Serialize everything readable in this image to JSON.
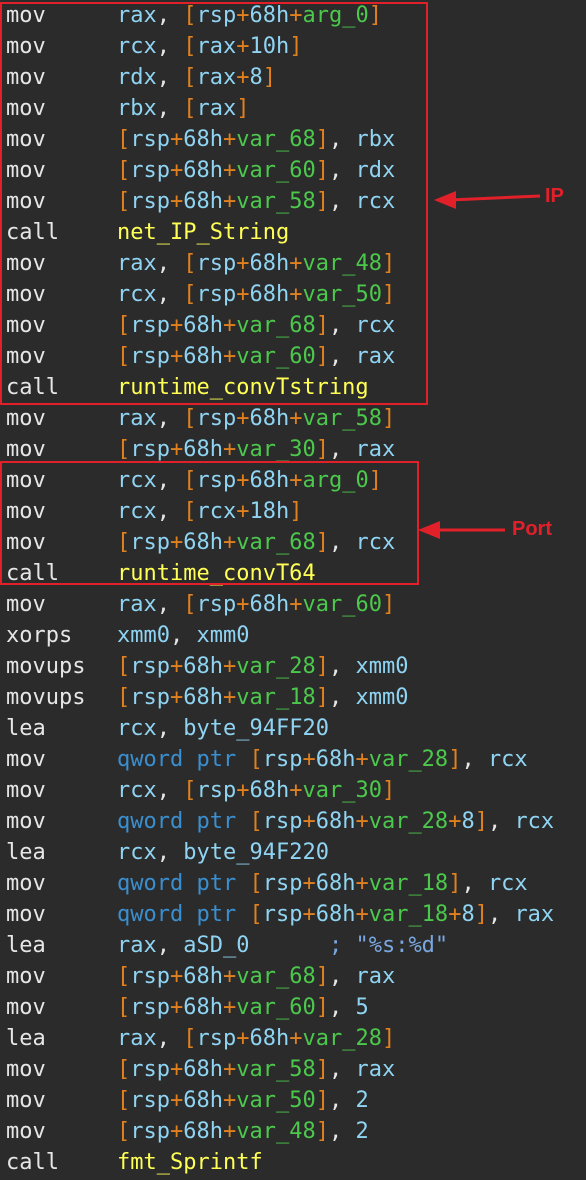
{
  "lines": [
    {
      "m": "mov",
      "t": [
        [
          "reg",
          "rax"
        ],
        [
          "punc",
          ", "
        ],
        [
          "br",
          "["
        ],
        [
          "reg",
          "rsp"
        ],
        [
          "plus",
          "+"
        ],
        [
          "num",
          "68h"
        ],
        [
          "plus",
          "+"
        ],
        [
          "var",
          "arg_0"
        ],
        [
          "br",
          "]"
        ]
      ]
    },
    {
      "m": "mov",
      "t": [
        [
          "reg",
          "rcx"
        ],
        [
          "punc",
          ", "
        ],
        [
          "br",
          "["
        ],
        [
          "reg",
          "rax"
        ],
        [
          "plus",
          "+"
        ],
        [
          "num",
          "10h"
        ],
        [
          "br",
          "]"
        ]
      ]
    },
    {
      "m": "mov",
      "t": [
        [
          "reg",
          "rdx"
        ],
        [
          "punc",
          ", "
        ],
        [
          "br",
          "["
        ],
        [
          "reg",
          "rax"
        ],
        [
          "plus",
          "+"
        ],
        [
          "num",
          "8"
        ],
        [
          "br",
          "]"
        ]
      ]
    },
    {
      "m": "mov",
      "t": [
        [
          "reg",
          "rbx"
        ],
        [
          "punc",
          ", "
        ],
        [
          "br",
          "["
        ],
        [
          "reg",
          "rax"
        ],
        [
          "br",
          "]"
        ]
      ]
    },
    {
      "m": "mov",
      "t": [
        [
          "br",
          "["
        ],
        [
          "reg",
          "rsp"
        ],
        [
          "plus",
          "+"
        ],
        [
          "num",
          "68h"
        ],
        [
          "plus",
          "+"
        ],
        [
          "var",
          "var_68"
        ],
        [
          "br",
          "]"
        ],
        [
          "punc",
          ", "
        ],
        [
          "reg",
          "rbx"
        ]
      ]
    },
    {
      "m": "mov",
      "t": [
        [
          "br",
          "["
        ],
        [
          "reg",
          "rsp"
        ],
        [
          "plus",
          "+"
        ],
        [
          "num",
          "68h"
        ],
        [
          "plus",
          "+"
        ],
        [
          "var",
          "var_60"
        ],
        [
          "br",
          "]"
        ],
        [
          "punc",
          ", "
        ],
        [
          "reg",
          "rdx"
        ]
      ]
    },
    {
      "m": "mov",
      "t": [
        [
          "br",
          "["
        ],
        [
          "reg",
          "rsp"
        ],
        [
          "plus",
          "+"
        ],
        [
          "num",
          "68h"
        ],
        [
          "plus",
          "+"
        ],
        [
          "var",
          "var_58"
        ],
        [
          "br",
          "]"
        ],
        [
          "punc",
          ", "
        ],
        [
          "reg",
          "rcx"
        ]
      ]
    },
    {
      "m": "call",
      "t": [
        [
          "func",
          "net_IP_String"
        ]
      ]
    },
    {
      "m": "mov",
      "t": [
        [
          "reg",
          "rax"
        ],
        [
          "punc",
          ", "
        ],
        [
          "br",
          "["
        ],
        [
          "reg",
          "rsp"
        ],
        [
          "plus",
          "+"
        ],
        [
          "num",
          "68h"
        ],
        [
          "plus",
          "+"
        ],
        [
          "var",
          "var_48"
        ],
        [
          "br",
          "]"
        ]
      ]
    },
    {
      "m": "mov",
      "t": [
        [
          "reg",
          "rcx"
        ],
        [
          "punc",
          ", "
        ],
        [
          "br",
          "["
        ],
        [
          "reg",
          "rsp"
        ],
        [
          "plus",
          "+"
        ],
        [
          "num",
          "68h"
        ],
        [
          "plus",
          "+"
        ],
        [
          "var",
          "var_50"
        ],
        [
          "br",
          "]"
        ]
      ]
    },
    {
      "m": "mov",
      "t": [
        [
          "br",
          "["
        ],
        [
          "reg",
          "rsp"
        ],
        [
          "plus",
          "+"
        ],
        [
          "num",
          "68h"
        ],
        [
          "plus",
          "+"
        ],
        [
          "var",
          "var_68"
        ],
        [
          "br",
          "]"
        ],
        [
          "punc",
          ", "
        ],
        [
          "reg",
          "rcx"
        ]
      ]
    },
    {
      "m": "mov",
      "t": [
        [
          "br",
          "["
        ],
        [
          "reg",
          "rsp"
        ],
        [
          "plus",
          "+"
        ],
        [
          "num",
          "68h"
        ],
        [
          "plus",
          "+"
        ],
        [
          "var",
          "var_60"
        ],
        [
          "br",
          "]"
        ],
        [
          "punc",
          ", "
        ],
        [
          "reg",
          "rax"
        ]
      ]
    },
    {
      "m": "call",
      "t": [
        [
          "func",
          "runtime_convTstring"
        ]
      ]
    },
    {
      "m": "mov",
      "t": [
        [
          "reg",
          "rax"
        ],
        [
          "punc",
          ", "
        ],
        [
          "br",
          "["
        ],
        [
          "reg",
          "rsp"
        ],
        [
          "plus",
          "+"
        ],
        [
          "num",
          "68h"
        ],
        [
          "plus",
          "+"
        ],
        [
          "var",
          "var_58"
        ],
        [
          "br",
          "]"
        ]
      ]
    },
    {
      "m": "mov",
      "t": [
        [
          "br",
          "["
        ],
        [
          "reg",
          "rsp"
        ],
        [
          "plus",
          "+"
        ],
        [
          "num",
          "68h"
        ],
        [
          "plus",
          "+"
        ],
        [
          "var",
          "var_30"
        ],
        [
          "br",
          "]"
        ],
        [
          "punc",
          ", "
        ],
        [
          "reg",
          "rax"
        ]
      ]
    },
    {
      "m": "mov",
      "t": [
        [
          "reg",
          "rcx"
        ],
        [
          "punc",
          ", "
        ],
        [
          "br",
          "["
        ],
        [
          "reg",
          "rsp"
        ],
        [
          "plus",
          "+"
        ],
        [
          "num",
          "68h"
        ],
        [
          "plus",
          "+"
        ],
        [
          "var",
          "arg_0"
        ],
        [
          "br",
          "]"
        ]
      ]
    },
    {
      "m": "mov",
      "t": [
        [
          "reg",
          "rcx"
        ],
        [
          "punc",
          ", "
        ],
        [
          "br",
          "["
        ],
        [
          "reg",
          "rcx"
        ],
        [
          "plus",
          "+"
        ],
        [
          "num",
          "18h"
        ],
        [
          "br",
          "]"
        ]
      ]
    },
    {
      "m": "mov",
      "t": [
        [
          "br",
          "["
        ],
        [
          "reg",
          "rsp"
        ],
        [
          "plus",
          "+"
        ],
        [
          "num",
          "68h"
        ],
        [
          "plus",
          "+"
        ],
        [
          "var",
          "var_68"
        ],
        [
          "br",
          "]"
        ],
        [
          "punc",
          ", "
        ],
        [
          "reg",
          "rcx"
        ]
      ]
    },
    {
      "m": "call",
      "t": [
        [
          "func",
          "runtime_convT64"
        ]
      ]
    },
    {
      "m": "mov",
      "t": [
        [
          "reg",
          "rax"
        ],
        [
          "punc",
          ", "
        ],
        [
          "br",
          "["
        ],
        [
          "reg",
          "rsp"
        ],
        [
          "plus",
          "+"
        ],
        [
          "num",
          "68h"
        ],
        [
          "plus",
          "+"
        ],
        [
          "var",
          "var_60"
        ],
        [
          "br",
          "]"
        ]
      ]
    },
    {
      "m": "xorps",
      "t": [
        [
          "reg",
          "xmm0"
        ],
        [
          "punc",
          ", "
        ],
        [
          "reg",
          "xmm0"
        ]
      ]
    },
    {
      "m": "movups",
      "t": [
        [
          "br",
          "["
        ],
        [
          "reg",
          "rsp"
        ],
        [
          "plus",
          "+"
        ],
        [
          "num",
          "68h"
        ],
        [
          "plus",
          "+"
        ],
        [
          "var",
          "var_28"
        ],
        [
          "br",
          "]"
        ],
        [
          "punc",
          ", "
        ],
        [
          "reg",
          "xmm0"
        ]
      ]
    },
    {
      "m": "movups",
      "t": [
        [
          "br",
          "["
        ],
        [
          "reg",
          "rsp"
        ],
        [
          "plus",
          "+"
        ],
        [
          "num",
          "68h"
        ],
        [
          "plus",
          "+"
        ],
        [
          "var",
          "var_18"
        ],
        [
          "br",
          "]"
        ],
        [
          "punc",
          ", "
        ],
        [
          "reg",
          "xmm0"
        ]
      ]
    },
    {
      "m": "lea",
      "t": [
        [
          "reg",
          "rcx"
        ],
        [
          "punc",
          ", "
        ],
        [
          "reg",
          "byte_94FF20"
        ]
      ]
    },
    {
      "m": "mov",
      "t": [
        [
          "kw",
          "qword ptr "
        ],
        [
          "br",
          "["
        ],
        [
          "reg",
          "rsp"
        ],
        [
          "plus",
          "+"
        ],
        [
          "num",
          "68h"
        ],
        [
          "plus",
          "+"
        ],
        [
          "var",
          "var_28"
        ],
        [
          "br",
          "]"
        ],
        [
          "punc",
          ", "
        ],
        [
          "reg",
          "rcx"
        ]
      ]
    },
    {
      "m": "mov",
      "t": [
        [
          "reg",
          "rcx"
        ],
        [
          "punc",
          ", "
        ],
        [
          "br",
          "["
        ],
        [
          "reg",
          "rsp"
        ],
        [
          "plus",
          "+"
        ],
        [
          "num",
          "68h"
        ],
        [
          "plus",
          "+"
        ],
        [
          "var",
          "var_30"
        ],
        [
          "br",
          "]"
        ]
      ]
    },
    {
      "m": "mov",
      "t": [
        [
          "kw",
          "qword ptr "
        ],
        [
          "br",
          "["
        ],
        [
          "reg",
          "rsp"
        ],
        [
          "plus",
          "+"
        ],
        [
          "num",
          "68h"
        ],
        [
          "plus",
          "+"
        ],
        [
          "var",
          "var_28"
        ],
        [
          "plus",
          "+"
        ],
        [
          "num",
          "8"
        ],
        [
          "br",
          "]"
        ],
        [
          "punc",
          ", "
        ],
        [
          "reg",
          "rcx"
        ]
      ]
    },
    {
      "m": "lea",
      "t": [
        [
          "reg",
          "rcx"
        ],
        [
          "punc",
          ", "
        ],
        [
          "reg",
          "byte_94F220"
        ]
      ]
    },
    {
      "m": "mov",
      "t": [
        [
          "kw",
          "qword ptr "
        ],
        [
          "br",
          "["
        ],
        [
          "reg",
          "rsp"
        ],
        [
          "plus",
          "+"
        ],
        [
          "num",
          "68h"
        ],
        [
          "plus",
          "+"
        ],
        [
          "var",
          "var_18"
        ],
        [
          "br",
          "]"
        ],
        [
          "punc",
          ", "
        ],
        [
          "reg",
          "rcx"
        ]
      ]
    },
    {
      "m": "mov",
      "t": [
        [
          "kw",
          "qword ptr "
        ],
        [
          "br",
          "["
        ],
        [
          "reg",
          "rsp"
        ],
        [
          "plus",
          "+"
        ],
        [
          "num",
          "68h"
        ],
        [
          "plus",
          "+"
        ],
        [
          "var",
          "var_18"
        ],
        [
          "plus",
          "+"
        ],
        [
          "num",
          "8"
        ],
        [
          "br",
          "]"
        ],
        [
          "punc",
          ", "
        ],
        [
          "reg",
          "rax"
        ]
      ]
    },
    {
      "m": "lea",
      "t": [
        [
          "reg",
          "rax"
        ],
        [
          "punc",
          ", "
        ],
        [
          "reg",
          "aSD_0"
        ],
        [
          "punc",
          "      "
        ],
        [
          "cmt",
          "; \"%s:%d\""
        ]
      ]
    },
    {
      "m": "mov",
      "t": [
        [
          "br",
          "["
        ],
        [
          "reg",
          "rsp"
        ],
        [
          "plus",
          "+"
        ],
        [
          "num",
          "68h"
        ],
        [
          "plus",
          "+"
        ],
        [
          "var",
          "var_68"
        ],
        [
          "br",
          "]"
        ],
        [
          "punc",
          ", "
        ],
        [
          "reg",
          "rax"
        ]
      ]
    },
    {
      "m": "mov",
      "t": [
        [
          "br",
          "["
        ],
        [
          "reg",
          "rsp"
        ],
        [
          "plus",
          "+"
        ],
        [
          "num",
          "68h"
        ],
        [
          "plus",
          "+"
        ],
        [
          "var",
          "var_60"
        ],
        [
          "br",
          "]"
        ],
        [
          "punc",
          ", "
        ],
        [
          "num",
          "5"
        ]
      ]
    },
    {
      "m": "lea",
      "t": [
        [
          "reg",
          "rax"
        ],
        [
          "punc",
          ", "
        ],
        [
          "br",
          "["
        ],
        [
          "reg",
          "rsp"
        ],
        [
          "plus",
          "+"
        ],
        [
          "num",
          "68h"
        ],
        [
          "plus",
          "+"
        ],
        [
          "var",
          "var_28"
        ],
        [
          "br",
          "]"
        ]
      ]
    },
    {
      "m": "mov",
      "t": [
        [
          "br",
          "["
        ],
        [
          "reg",
          "rsp"
        ],
        [
          "plus",
          "+"
        ],
        [
          "num",
          "68h"
        ],
        [
          "plus",
          "+"
        ],
        [
          "var",
          "var_58"
        ],
        [
          "br",
          "]"
        ],
        [
          "punc",
          ", "
        ],
        [
          "reg",
          "rax"
        ]
      ]
    },
    {
      "m": "mov",
      "t": [
        [
          "br",
          "["
        ],
        [
          "reg",
          "rsp"
        ],
        [
          "plus",
          "+"
        ],
        [
          "num",
          "68h"
        ],
        [
          "plus",
          "+"
        ],
        [
          "var",
          "var_50"
        ],
        [
          "br",
          "]"
        ],
        [
          "punc",
          ", "
        ],
        [
          "num",
          "2"
        ]
      ]
    },
    {
      "m": "mov",
      "t": [
        [
          "br",
          "["
        ],
        [
          "reg",
          "rsp"
        ],
        [
          "plus",
          "+"
        ],
        [
          "num",
          "68h"
        ],
        [
          "plus",
          "+"
        ],
        [
          "var",
          "var_48"
        ],
        [
          "br",
          "]"
        ],
        [
          "punc",
          ", "
        ],
        [
          "num",
          "2"
        ]
      ]
    },
    {
      "m": "call",
      "t": [
        [
          "func",
          "fmt_Sprintf"
        ]
      ]
    }
  ],
  "annotations": {
    "ip_label": "IP",
    "port_label": "Port",
    "annotation_color": "#e2202a"
  }
}
